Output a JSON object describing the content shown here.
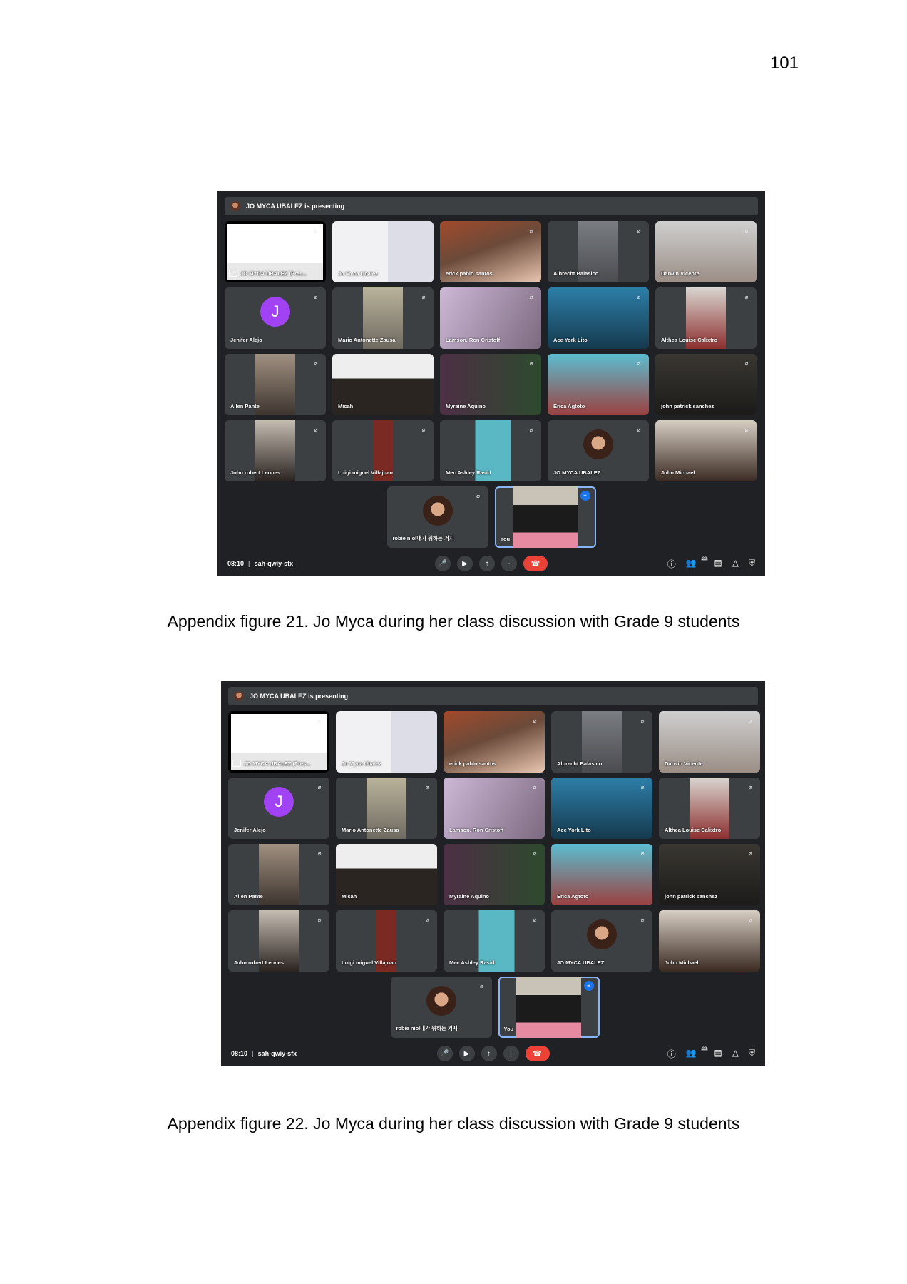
{
  "page_number": "101",
  "figures": [
    {
      "caption": "Appendix figure 21. Jo Myca during her class discussion with Grade 9 students",
      "meet": {
        "presenting_text": "JO MYCA UBALEZ is presenting",
        "tiles": [
          {
            "name": "JO MYCA UBALEZ (Pres..."
          },
          {
            "name": "Jo Myca Ubalez"
          },
          {
            "name": "erick pablo santos"
          },
          {
            "name": "Albrecht Balasico"
          },
          {
            "name": "Darwin Vicente"
          },
          {
            "name": "Jenifer Alejo",
            "avatar": "J"
          },
          {
            "name": "Mario Antonette Zausa"
          },
          {
            "name": "Lamson, Ron Cristoff"
          },
          {
            "name": "Ace York Lito"
          },
          {
            "name": "Althea Louise Calixtro"
          },
          {
            "name": "Allen Pante"
          },
          {
            "name": "Micah"
          },
          {
            "name": "Myraine Aquino"
          },
          {
            "name": "Erica Agtoto"
          },
          {
            "name": "john patrick sanchez"
          },
          {
            "name": "John robert Leones"
          },
          {
            "name": "Luigi miguel Villajuan"
          },
          {
            "name": "Mec Ashley Rasid"
          },
          {
            "name": "JO MYCA UBALEZ"
          },
          {
            "name": "John Michael"
          }
        ],
        "bottom_tiles": [
          {
            "name": "robie niol내가 뭐하는 거지"
          },
          {
            "name": "You"
          }
        ],
        "time": "08:10",
        "meeting_code": "sah-qwiy-sfx",
        "participants_count": "22"
      }
    },
    {
      "caption": "Appendix figure 22. Jo Myca during her class discussion with Grade 9 students",
      "meet": {
        "presenting_text": "JO MYCA UBALEZ is presenting",
        "tiles": [
          {
            "name": "JO MYCA UBALEZ (Pres..."
          },
          {
            "name": "Jo Myca Ubalez"
          },
          {
            "name": "erick pablo santos"
          },
          {
            "name": "Albrecht Balasico"
          },
          {
            "name": "Darwin Vicente"
          },
          {
            "name": "Jenifer Alejo",
            "avatar": "J"
          },
          {
            "name": "Mario Antonette Zausa"
          },
          {
            "name": "Lamson, Ron Cristoff"
          },
          {
            "name": "Ace York Lito"
          },
          {
            "name": "Althea Louise Calixtro"
          },
          {
            "name": "Allen Pante"
          },
          {
            "name": "Micah"
          },
          {
            "name": "Myraine Aquino"
          },
          {
            "name": "Erica Agtoto"
          },
          {
            "name": "john patrick sanchez"
          },
          {
            "name": "John robert Leones"
          },
          {
            "name": "Luigi miguel Villajuan"
          },
          {
            "name": "Mec Ashley Rasid"
          },
          {
            "name": "JO MYCA UBALEZ"
          },
          {
            "name": "John Michael"
          }
        ],
        "bottom_tiles": [
          {
            "name": "robie niol내가 뭐하는 거지"
          },
          {
            "name": "You"
          }
        ],
        "time": "08:10",
        "meeting_code": "sah-qwiy-sfx",
        "participants_count": "22"
      }
    }
  ]
}
